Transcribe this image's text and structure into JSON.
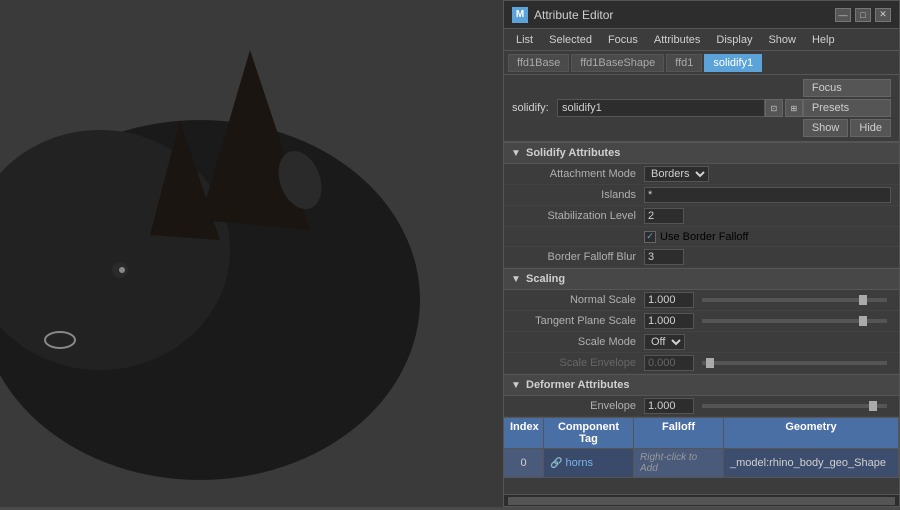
{
  "viewport": {
    "background_color": "#3a3a3a"
  },
  "window": {
    "title": "Attribute Editor",
    "icon": "M",
    "min_btn": "—",
    "max_btn": "□",
    "close_btn": "✕"
  },
  "menubar": {
    "items": [
      "List",
      "Selected",
      "Focus",
      "Attributes",
      "Display",
      "Show",
      "Help"
    ]
  },
  "tabs": [
    {
      "label": "ffd1Base",
      "active": false
    },
    {
      "label": "ffd1BaseShape",
      "active": false
    },
    {
      "label": "ffd1",
      "active": false
    },
    {
      "label": "solidify1",
      "active": true
    }
  ],
  "solidify_row": {
    "label": "solidify:",
    "value": "solidify1",
    "focus_btn": "Focus",
    "presets_btn": "Presets",
    "show_btn": "Show",
    "hide_btn": "Hide"
  },
  "sections": {
    "solidify_attributes": {
      "title": "Solidify Attributes",
      "fields": {
        "attachment_mode_label": "Attachment Mode",
        "attachment_mode_value": "Borders",
        "islands_label": "Islands",
        "islands_value": "*",
        "stabilization_level_label": "Stabilization Level",
        "stabilization_level_value": "2",
        "use_border_falloff_label": "Use Border Falloff",
        "use_border_falloff_checked": true,
        "border_falloff_blur_label": "Border Falloff Blur",
        "border_falloff_blur_value": "3"
      }
    },
    "scaling": {
      "title": "Scaling",
      "fields": {
        "normal_scale_label": "Normal Scale",
        "normal_scale_value": "1.000",
        "normal_scale_slider": 0.9,
        "tangent_plane_scale_label": "Tangent Plane Scale",
        "tangent_plane_scale_value": "1.000",
        "tangent_plane_scale_slider": 0.9,
        "scale_mode_label": "Scale Mode",
        "scale_mode_value": "Off",
        "scale_envelope_label": "Scale Envelope",
        "scale_envelope_value": "0.000",
        "scale_envelope_slider": 0.0
      }
    },
    "deformer_attributes": {
      "title": "Deformer Attributes",
      "fields": {
        "envelope_label": "Envelope",
        "envelope_value": "1.000",
        "envelope_slider": 0.95
      }
    }
  },
  "table": {
    "headers": [
      "Index",
      "Component Tag",
      "Falloff",
      "Geometry"
    ],
    "header_widths": [
      40,
      90,
      90,
      150
    ],
    "rows": [
      {
        "index": "0",
        "component_tag": "horns",
        "falloff": "Right-click to Add",
        "geometry": "_model:rhino_body_geo_Shape"
      }
    ]
  }
}
